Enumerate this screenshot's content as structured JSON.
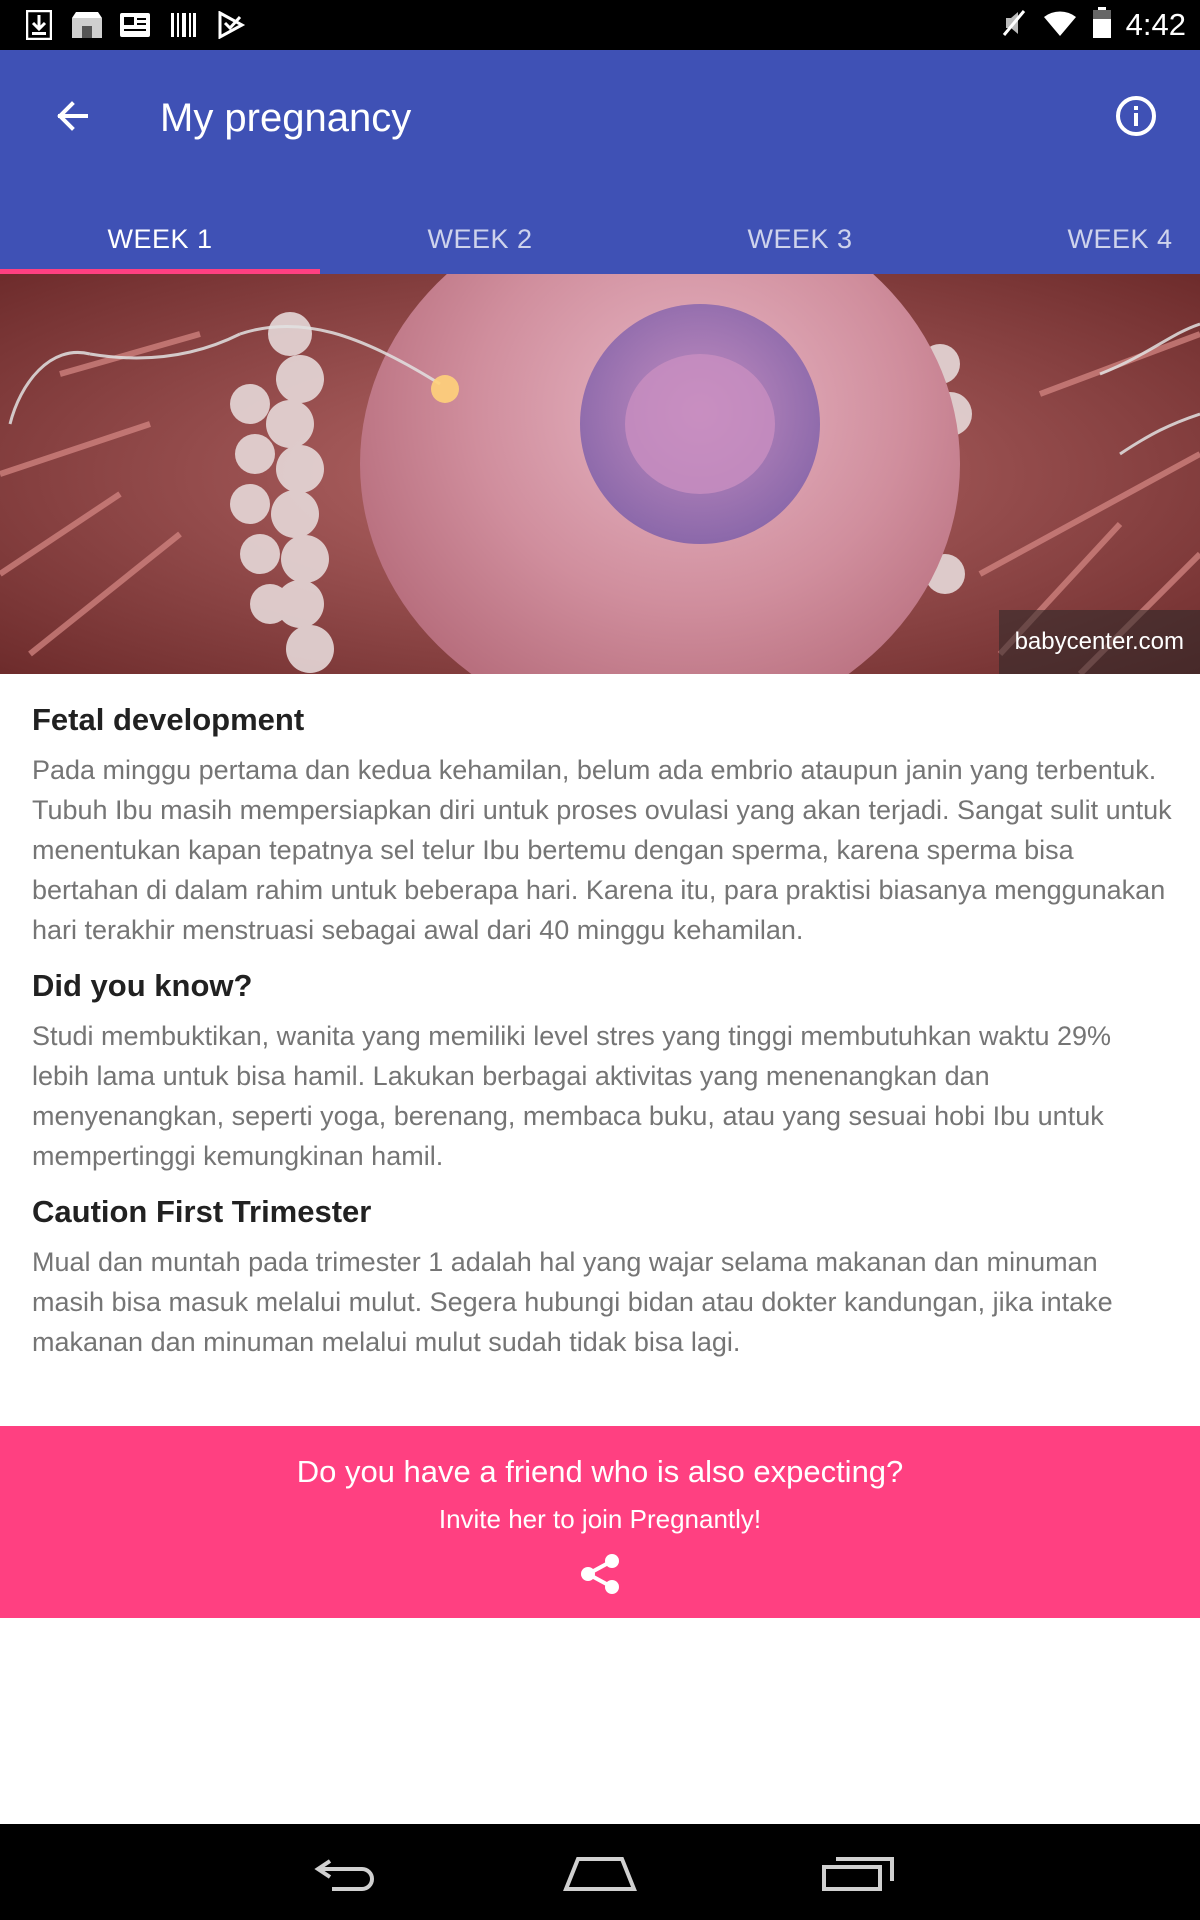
{
  "status_bar": {
    "time": "4:42",
    "left_icons": [
      "download-icon",
      "store-icon",
      "news-icon",
      "barcode-icon",
      "play-store-icon"
    ],
    "right_icons": [
      "mute-icon",
      "wifi-icon",
      "battery-icon"
    ]
  },
  "app_bar": {
    "title": "My pregnancy",
    "back_icon": "arrow-back-icon",
    "info_icon": "info-icon",
    "color": "#3f51b5"
  },
  "tabs": [
    {
      "label": "WEEK 1",
      "active": true
    },
    {
      "label": "WEEK 2",
      "active": false
    },
    {
      "label": "WEEK 3",
      "active": false
    },
    {
      "label": "WEEK 4",
      "active": false
    }
  ],
  "hero": {
    "credit": "babycenter.com"
  },
  "sections": [
    {
      "heading": "Fetal development",
      "body": "Pada minggu pertama dan kedua kehamilan, belum ada embrio ataupun janin yang terbentuk. Tubuh Ibu masih mempersiapkan diri untuk proses ovulasi yang akan terjadi. Sangat sulit untuk menentukan kapan tepatnya sel telur Ibu bertemu dengan sperma, karena sperma bisa bertahan di dalam rahim untuk beberapa hari. Karena itu, para praktisi biasanya menggunakan hari terakhir menstruasi sebagai awal dari 40 minggu kehamilan."
    },
    {
      "heading": "Did you know?",
      "body": "Studi membuktikan, wanita yang memiliki level stres yang tinggi membutuhkan waktu 29% lebih lama untuk bisa hamil. Lakukan berbagai aktivitas yang menenangkan dan menyenangkan, seperti yoga, berenang, membaca buku, atau yang sesuai hobi Ibu untuk mempertinggi kemungkinan hamil."
    },
    {
      "heading": "Caution First Trimester",
      "body": "Mual dan muntah pada trimester 1 adalah hal yang wajar selama makanan dan minuman masih bisa masuk melalui mulut. Segera hubungi bidan atau dokter kandungan, jika intake makanan dan minuman melalui mulut sudah tidak bisa lagi."
    }
  ],
  "invite": {
    "question": "Do you have a friend who is also expecting?",
    "subtitle": "Invite her to join Pregnantly!",
    "share_icon": "share-icon",
    "color": "#ff4081"
  },
  "nav_bar": {
    "icons": [
      "back-nav-icon",
      "home-nav-icon",
      "recents-nav-icon"
    ]
  }
}
